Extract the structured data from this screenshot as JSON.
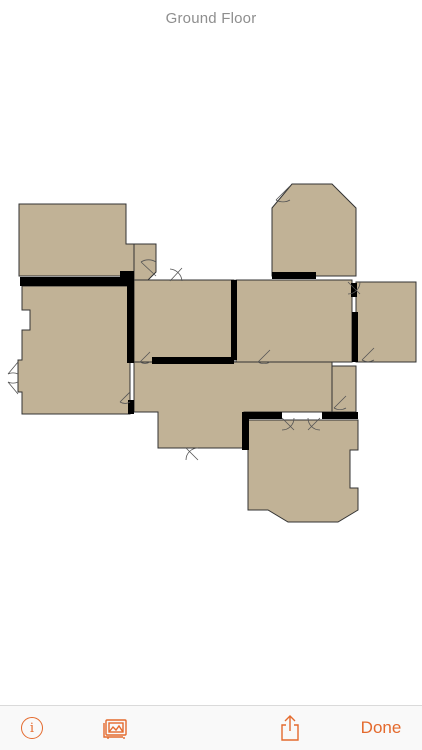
{
  "header": {
    "title": "Ground Floor"
  },
  "floor_plan": {
    "floor_color": "#c1b296",
    "wall_color": "#000000",
    "outline_color": "#333333"
  },
  "toolbar": {
    "info_icon": "info-circle-icon",
    "info_glyph": "i",
    "gallery_icon": "photo-gallery-icon",
    "share_icon": "share-icon",
    "done_label": "Done",
    "accent_color": "#e46a2d"
  }
}
